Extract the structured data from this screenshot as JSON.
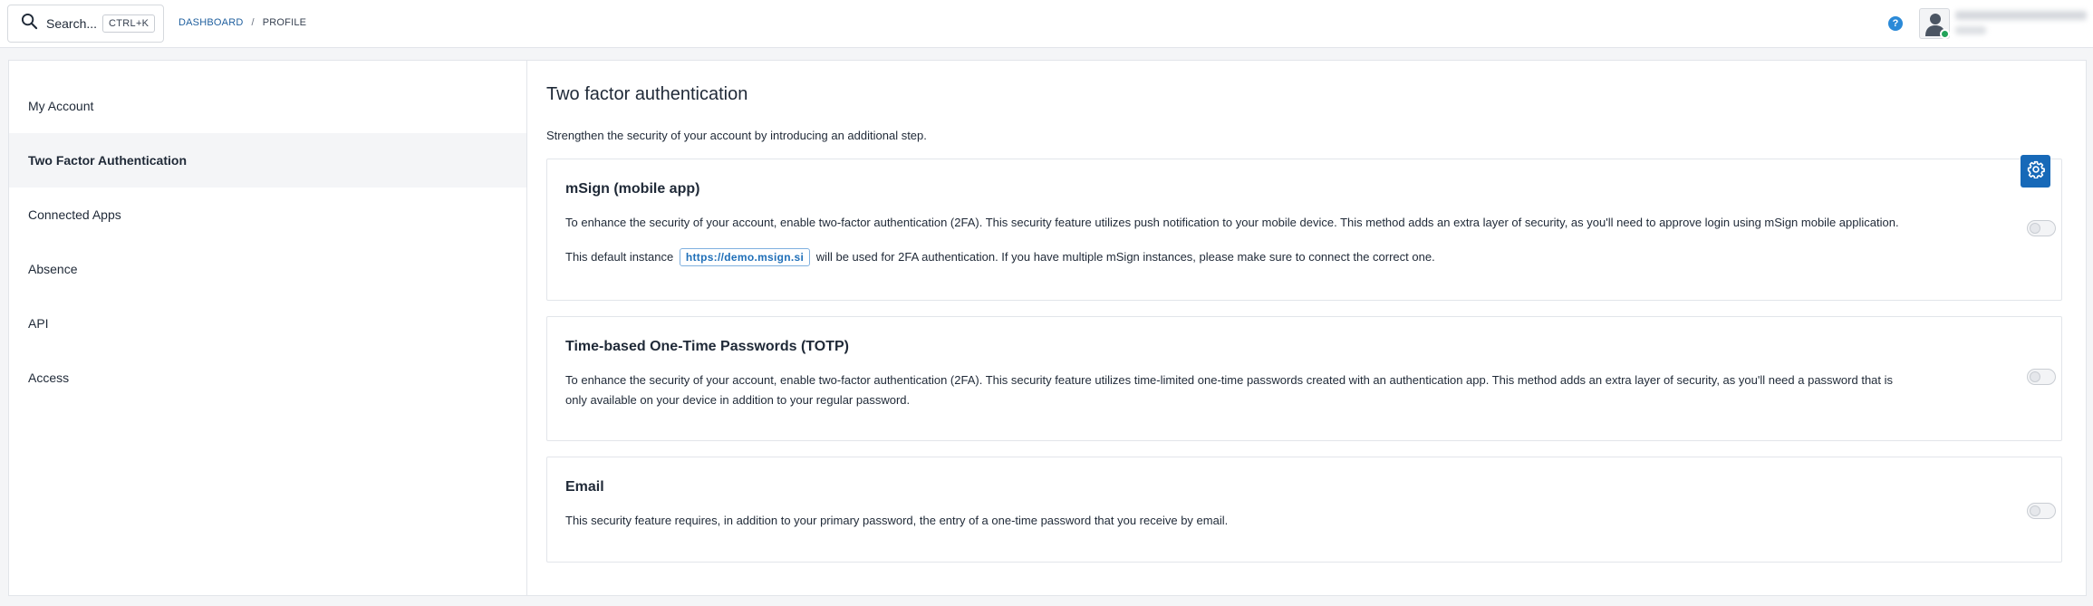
{
  "topbar": {
    "search_label": "Search...",
    "search_shortcut": "CTRL+K",
    "breadcrumb": {
      "dashboard": "DASHBOARD",
      "separator": "/",
      "current": "PROFILE"
    },
    "help_symbol": "?"
  },
  "sidebar": {
    "items": [
      {
        "label": "My Account"
      },
      {
        "label": "Two Factor Authentication"
      },
      {
        "label": "Connected Apps"
      },
      {
        "label": "Absence"
      },
      {
        "label": "API"
      },
      {
        "label": "Access"
      }
    ],
    "active_index": 1
  },
  "content": {
    "title": "Two factor authentication",
    "description": "Strengthen the security of your account by introducing an additional step.",
    "cards": [
      {
        "title": "mSign (mobile app)",
        "text": "To enhance the security of your account, enable two-factor authentication (2FA). This security feature utilizes push notification to your mobile device. This method adds an extra layer of security, as you'll need to approve login using mSign mobile application.",
        "instance_prefix": "This default instance",
        "instance_url": "https://demo.msign.si",
        "instance_suffix": "will be used for 2FA authentication. If you have multiple mSign instances, please make sure to connect the correct one.",
        "enabled": false
      },
      {
        "title": "Time-based One-Time Passwords (TOTP)",
        "text_line1": "To enhance the security of your account, enable two-factor authentication (2FA). This security feature utilizes time-limited one-time passwords created with an authentication app. This method adds an extra layer of security, as you'll need a password that is",
        "text_line2": "only available on your device in addition to your regular password.",
        "enabled": false
      },
      {
        "title": "Email",
        "text": "This security feature requires, in addition to your primary password, the entry of a one-time password that you receive by email.",
        "enabled": false
      }
    ]
  },
  "colors": {
    "accent": "#1769b8",
    "link": "#1f5f9e",
    "help": "#2b8ad8",
    "status_online": "#22a35a"
  },
  "icons": {
    "search": "search-icon",
    "help": "help-icon",
    "avatar": "user-avatar-icon",
    "settings": "gear-icon"
  }
}
